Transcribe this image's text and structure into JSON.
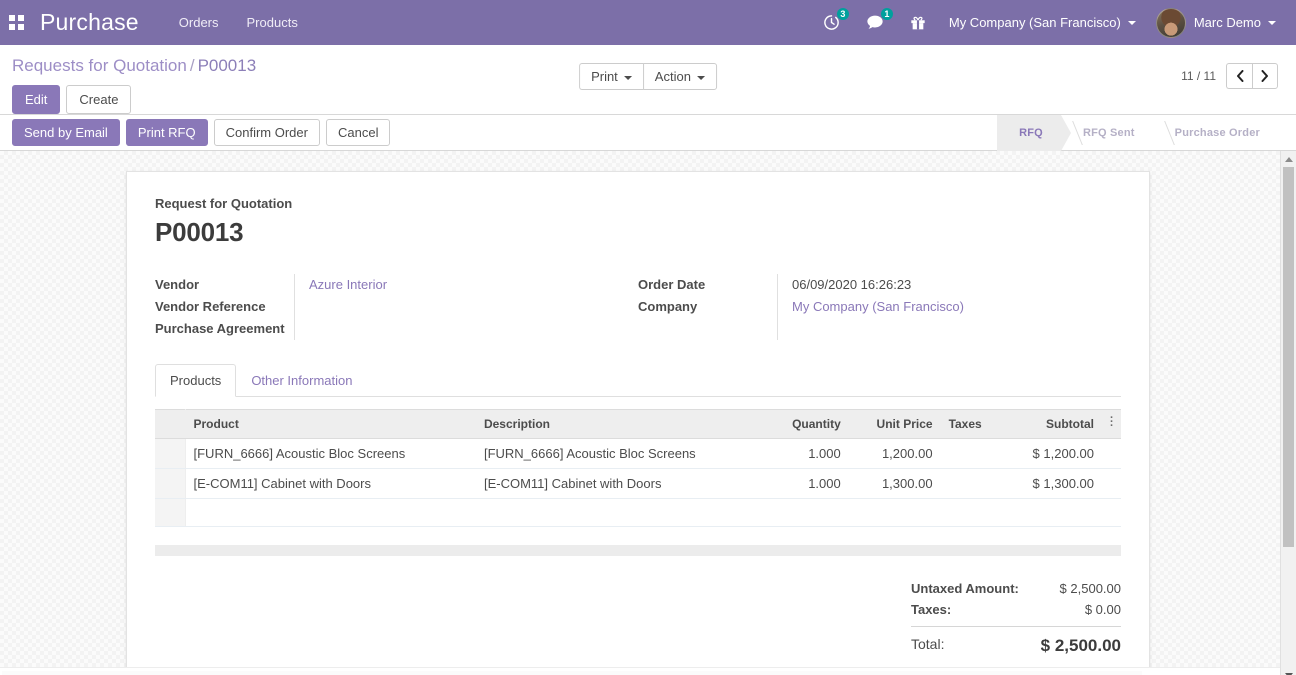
{
  "navbar": {
    "apps_icon": "apps-grid-icon",
    "brand": "Purchase",
    "menu": [
      {
        "label": "Orders"
      },
      {
        "label": "Products"
      }
    ],
    "activity_icon": "clock-icon",
    "activity_count": "3",
    "messages_icon": "chat-bubble-icon",
    "messages_count": "1",
    "gift_icon": "gift-icon",
    "company": "My Company (San Francisco)",
    "user": "Marc Demo",
    "avatar_icon": "user-avatar"
  },
  "control_panel": {
    "breadcrumb_root": "Requests for Quotation",
    "breadcrumb_sep": "/",
    "breadcrumb_current": "P00013",
    "edit_label": "Edit",
    "create_label": "Create",
    "print_label": "Print",
    "action_label": "Action",
    "pager_value": "11 / 11",
    "pager_prev_icon": "chevron-left-icon",
    "pager_next_icon": "chevron-right-icon"
  },
  "statusbar": {
    "buttons": [
      {
        "label": "Send by Email",
        "style": "primary"
      },
      {
        "label": "Print RFQ",
        "style": "primary"
      },
      {
        "label": "Confirm Order",
        "style": "secondary"
      },
      {
        "label": "Cancel",
        "style": "secondary"
      }
    ],
    "stages": [
      {
        "label": "RFQ",
        "state": "done"
      },
      {
        "label": "RFQ Sent",
        "state": "todo"
      },
      {
        "label": "Purchase Order",
        "state": "todo"
      }
    ]
  },
  "form": {
    "subtitle": "Request for Quotation",
    "title": "P00013",
    "left_fields": [
      {
        "label": "Vendor",
        "value": "Azure Interior",
        "type": "link"
      },
      {
        "label": "Vendor Reference",
        "value": "",
        "type": "text"
      },
      {
        "label": "Purchase Agreement",
        "value": "",
        "type": "text"
      }
    ],
    "right_fields": [
      {
        "label": "Order Date",
        "value": "06/09/2020 16:26:23",
        "type": "text"
      },
      {
        "label": "Company",
        "value": "My Company (San Francisco)",
        "type": "link"
      }
    ],
    "tabs": [
      {
        "label": "Products",
        "active": true
      },
      {
        "label": "Other Information",
        "active": false
      }
    ],
    "lines": {
      "columns": [
        "Product",
        "Description",
        "Quantity",
        "Unit Price",
        "Taxes",
        "Subtotal"
      ],
      "rows": [
        {
          "product": "[FURN_6666] Acoustic Bloc Screens",
          "description": "[FURN_6666] Acoustic Bloc Screens",
          "quantity": "1.000",
          "unit_price": "1,200.00",
          "taxes": "",
          "subtotal": "$ 1,200.00"
        },
        {
          "product": "[E-COM11] Cabinet with Doors",
          "description": "[E-COM11] Cabinet with Doors",
          "quantity": "1.000",
          "unit_price": "1,300.00",
          "taxes": "",
          "subtotal": "$ 1,300.00"
        }
      ],
      "options_icon": "column-options-icon"
    },
    "totals": [
      {
        "label": "Untaxed Amount:",
        "value": "$ 2,500.00"
      },
      {
        "label": "Taxes:",
        "value": "$ 0.00"
      }
    ],
    "total": {
      "label": "Total:",
      "value": "$ 2,500.00"
    }
  },
  "colors": {
    "brand_purple": "#7c6fa8",
    "accent_purple": "#8a78b8",
    "badge_teal": "#00a09d",
    "sheet_bg": "#ffffff"
  }
}
